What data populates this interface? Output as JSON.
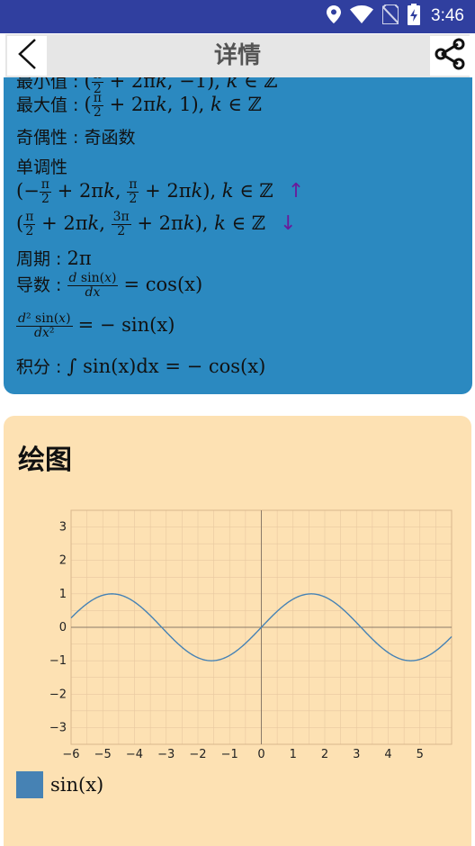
{
  "status": {
    "time": "3:46"
  },
  "appbar": {
    "title": "详情"
  },
  "props": {
    "min_label": "最小值",
    "max_label": "最大值",
    "max_value": "(π/2 + 2πk, 1), k ∈ ℤ",
    "parity_label": "奇偶性",
    "parity_value": "奇函数",
    "monotonic_label": "单调性",
    "period_label": "周期",
    "period_value": "2π",
    "derivative_label": "导数",
    "derivative_value": "cos(x)",
    "second_derivative_value": "− sin(x)",
    "integral_label": "积分",
    "integral_value": "∫ sin(x)dx = − cos(x)"
  },
  "plot": {
    "title": "绘图",
    "legend": "sin(x)"
  },
  "colors": {
    "status_bar": "#303f9f",
    "card_blue": "#2b89c0",
    "card_peach": "#fde1b3",
    "series": "#4682b4",
    "arrow": "#6a1b9a"
  },
  "chart_data": {
    "type": "line",
    "xlim": [
      -6,
      6
    ],
    "ylim": [
      -3.5,
      3.5
    ],
    "xticks": [
      -6,
      -5,
      -4,
      -3,
      -2,
      -1,
      0,
      1,
      2,
      3,
      4,
      5
    ],
    "yticks": [
      -3,
      -2,
      -1,
      0,
      1,
      2,
      3
    ],
    "grid": true,
    "legend_position": "bottom-left",
    "series": [
      {
        "name": "sin(x)",
        "function": "sin"
      }
    ]
  }
}
